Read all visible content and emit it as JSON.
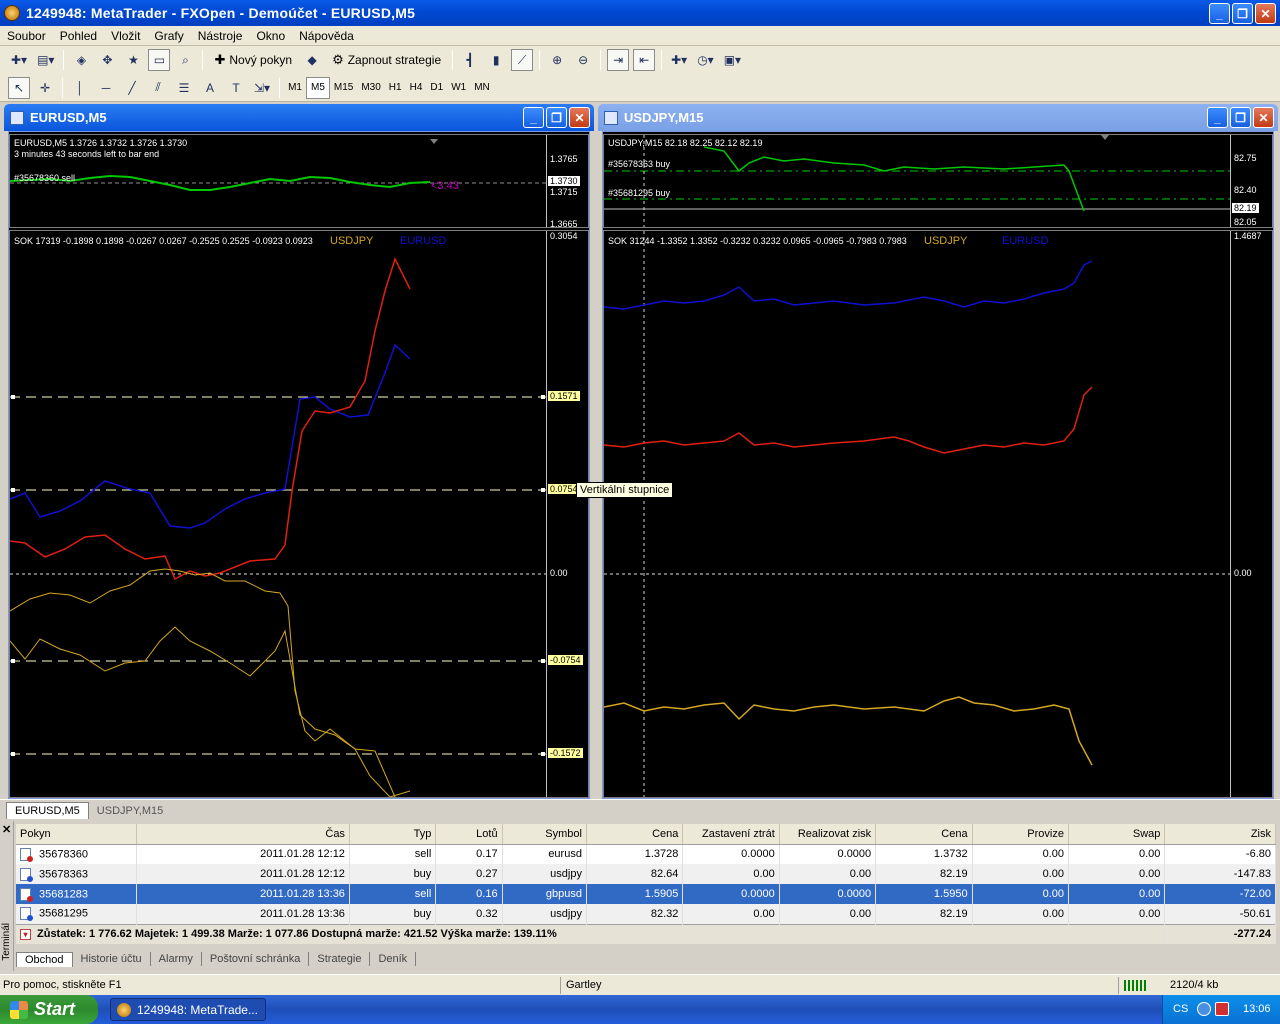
{
  "window": {
    "title": "1249948: MetaTrader - FXOpen - Demoúčet - EURUSD,M5"
  },
  "menu": [
    "Soubor",
    "Pohled",
    "Vložit",
    "Grafy",
    "Nástroje",
    "Okno",
    "Nápověda"
  ],
  "toolbar": {
    "new_order": "Nový pokyn",
    "strategies": "Zapnout strategie"
  },
  "timeframes": [
    "M1",
    "M5",
    "M15",
    "M30",
    "H1",
    "H4",
    "D1",
    "W1",
    "MN"
  ],
  "chart1": {
    "title": "EURUSD,M5",
    "header": "EURUSD,M5  1.3726 1.3732 1.3726 1.3730",
    "timer": "3 minutes 43 seconds left to bar end",
    "order_label": "#35678360 sell",
    "profit_label": "<3.43",
    "price_scale": [
      "1.3765",
      "1.3730",
      "1.3715",
      "1.3665"
    ],
    "indicator_header": "SOK 17319 -0.1898 0.1898 -0.0267 0.0267 -0.2525 0.2525 -0.0923 0.0923",
    "ind_symbol1": "USDJPY",
    "ind_symbol2": "EURUSD",
    "indicator_scale": [
      "0.3054",
      "0.1571",
      "0.0754",
      "0.00",
      "-0.0754",
      "-0.1572"
    ]
  },
  "chart2": {
    "title": "USDJPY,M15",
    "header": "USDJPY,M15  82.18 82.25 82.12 82.19",
    "order_label1": "#35678363 buy",
    "order_label2": "#35681295 buy",
    "price_scale": [
      "82.75",
      "82.40",
      "82.19",
      "82.05"
    ],
    "indicator_header": "SOK 31244 -1.3352 1.3352 -0.3232 0.3232 0.0965 -0.0965 -0.7983 0.7983",
    "ind_symbol1": "USDJPY",
    "ind_symbol2": "EURUSD",
    "indicator_scale": [
      "1.4687",
      "0.00"
    ]
  },
  "tooltip": "Vertikální stupnice",
  "chart_tabs": [
    "EURUSD,M5",
    "USDJPY,M15"
  ],
  "terminal": {
    "side_label": "Terminál",
    "columns": [
      "Pokyn",
      "Čas",
      "Typ",
      "Lotů",
      "Symbol",
      "Cena",
      "Zastavení ztrát",
      "Realizovat zisk",
      "Cena",
      "Provize",
      "Swap",
      "Zisk"
    ],
    "rows": [
      {
        "order": "35678360",
        "time": "2011.01.28 12:12",
        "type": "sell",
        "lots": "0.17",
        "symbol": "eurusd",
        "price": "1.3728",
        "sl": "0.0000",
        "tp": "0.0000",
        "cur_price": "1.3732",
        "commission": "0.00",
        "swap": "0.00",
        "profit": "-6.80"
      },
      {
        "order": "35678363",
        "time": "2011.01.28 12:12",
        "type": "buy",
        "lots": "0.27",
        "symbol": "usdjpy",
        "price": "82.64",
        "sl": "0.00",
        "tp": "0.00",
        "cur_price": "82.19",
        "commission": "0.00",
        "swap": "0.00",
        "profit": "-147.83"
      },
      {
        "order": "35681283",
        "time": "2011.01.28 13:36",
        "type": "sell",
        "lots": "0.16",
        "symbol": "gbpusd",
        "price": "1.5905",
        "sl": "0.0000",
        "tp": "0.0000",
        "cur_price": "1.5950",
        "commission": "0.00",
        "swap": "0.00",
        "profit": "-72.00"
      },
      {
        "order": "35681295",
        "time": "2011.01.28 13:36",
        "type": "buy",
        "lots": "0.32",
        "symbol": "usdjpy",
        "price": "82.32",
        "sl": "0.00",
        "tp": "0.00",
        "cur_price": "82.19",
        "commission": "0.00",
        "swap": "0.00",
        "profit": "-50.61"
      }
    ],
    "summary": "Zůstatek: 1 776.62  Majetek: 1 499.38  Marže: 1 077.86  Dostupná marže: 421.52  Výška marže: 139.11%",
    "total_profit": "-277.24",
    "tabs": [
      "Obchod",
      "Historie účtu",
      "Alarmy",
      "Poštovní schránka",
      "Strategie",
      "Deník"
    ]
  },
  "status": {
    "help": "Pro pomoc, stiskněte F1",
    "profile": "Gartley",
    "traffic": "2120/4 kb"
  },
  "taskbar": {
    "start": "Start",
    "task": "1249948: MetaTrade...",
    "lang": "CS",
    "clock": "13:06"
  },
  "colors": {
    "price_line": "#00c800",
    "usdjpy_line": "#d4a820",
    "eurusd_line": "#1010d0",
    "red_line": "#e02010",
    "profit_text": "#c000c0"
  }
}
